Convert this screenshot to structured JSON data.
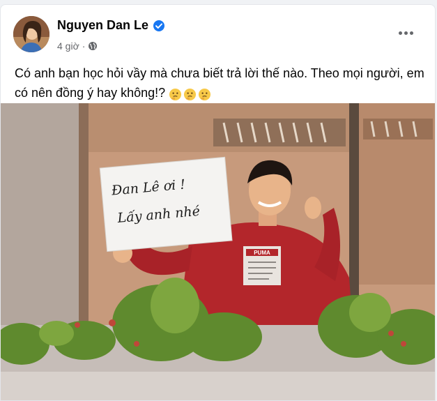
{
  "post": {
    "author_name": "Nguyen Dan Le",
    "time": "4 giờ",
    "separator": "·",
    "text": "Có anh bạn học hỏi vầy mà chưa biết trả lời thế nào. Theo mọi người, em có nên đồng ý hay không!?"
  },
  "photo": {
    "sign_line1": "Đan Lê ơi !",
    "sign_line2": "Lấy anh nhé",
    "shirt_logo": "PUMA"
  },
  "icons": {
    "verified": "verified-badge-icon",
    "audience": "globe-icon",
    "more": "more-options-icon",
    "emoji": "thinking-face-emoji"
  },
  "colors": {
    "accent": "#1877f2",
    "text_primary": "#050505",
    "text_secondary": "#65676b"
  }
}
